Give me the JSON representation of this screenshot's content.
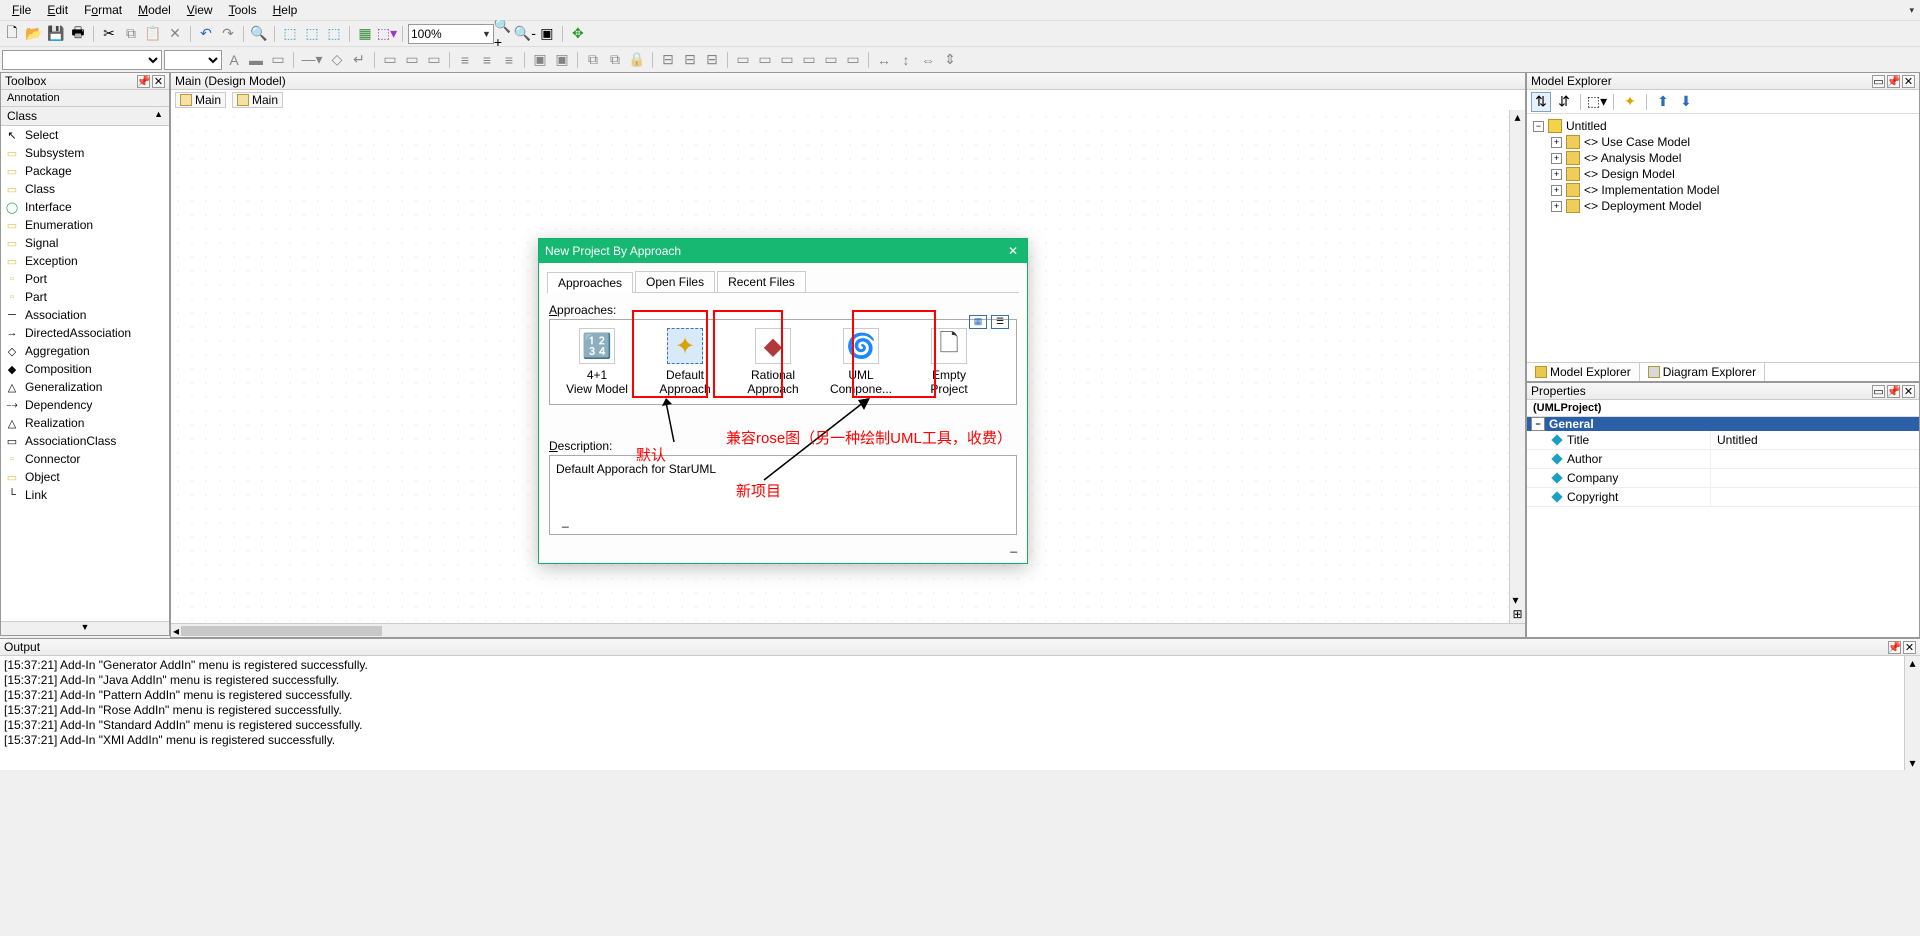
{
  "menubar": {
    "items": [
      "File",
      "Edit",
      "Format",
      "Model",
      "View",
      "Tools",
      "Help"
    ]
  },
  "toolbar_zoom": "100%",
  "toolbox": {
    "title": "Toolbox",
    "sections": [
      "Annotation",
      "Class"
    ],
    "items": [
      "Select",
      "Subsystem",
      "Package",
      "Class",
      "Interface",
      "Enumeration",
      "Signal",
      "Exception",
      "Port",
      "Part",
      "Association",
      "DirectedAssociation",
      "Aggregation",
      "Composition",
      "Generalization",
      "Dependency",
      "Realization",
      "AssociationClass",
      "Connector",
      "Object",
      "Link"
    ]
  },
  "canvas": {
    "title": "Main (Design Model)",
    "tabs": [
      "Main",
      "Main"
    ]
  },
  "explorer": {
    "title": "Model Explorer",
    "root": "Untitled",
    "nodes": [
      "<<useCaseModel>> Use Case Model",
      "<<analysisModel>> Analysis Model",
      "<<designModel>> Design Model",
      "<<implementationModel>> Implementation Model",
      "<<deploymentModel>> Deployment Model"
    ],
    "bottom_tabs": [
      "Model Explorer",
      "Diagram Explorer"
    ]
  },
  "properties": {
    "title": "Properties",
    "object_name": "(UMLProject)",
    "category": "General",
    "rows": [
      {
        "k": "Title",
        "v": "Untitled"
      },
      {
        "k": "Author",
        "v": ""
      },
      {
        "k": "Company",
        "v": ""
      },
      {
        "k": "Copyright",
        "v": ""
      }
    ]
  },
  "output": {
    "title": "Output",
    "lines": [
      "[15:37:21]   Add-In \"Generator AddIn\" menu is registered successfully.",
      "[15:37:21]   Add-In \"Java AddIn\" menu is registered successfully.",
      "[15:37:21]   Add-In \"Pattern AddIn\" menu is registered successfully.",
      "[15:37:21]   Add-In \"Rose AddIn\" menu is registered successfully.",
      "[15:37:21]   Add-In \"Standard AddIn\" menu is registered successfully.",
      "[15:37:21]   Add-In \"XMI AddIn\" menu is registered successfully."
    ]
  },
  "dialog": {
    "title": "New Project By Approach",
    "tabs": [
      "Approaches",
      "Open Files",
      "Recent Files"
    ],
    "section_label": "Approaches:",
    "approaches": [
      {
        "name": "4+1 View Model"
      },
      {
        "name": "Default Approach"
      },
      {
        "name": "Rational Approach"
      },
      {
        "name": "UML Compone..."
      },
      {
        "name": "Empty Project"
      }
    ],
    "desc_label": "Description:",
    "description": "Default Apporach for StarUML",
    "desc_dash": "_",
    "footer_dash": "_"
  },
  "annotations": {
    "default": "默认",
    "rose": "兼容rose图（另一种绘制UML工具，收费）",
    "new_project": "新项目"
  }
}
